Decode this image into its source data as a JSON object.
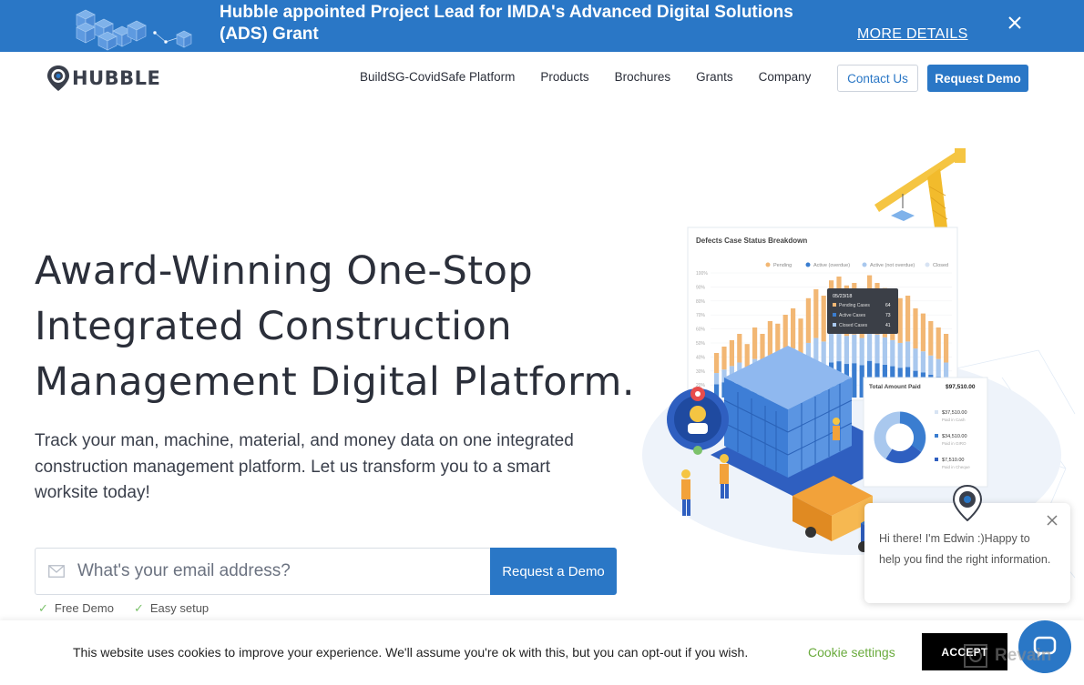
{
  "banner": {
    "text": "Hubble appointed Project Lead for IMDA's Advanced Digital Solutions (ADS) Grant",
    "link_label": "MORE DETAILS"
  },
  "nav": {
    "logo_text": "HUBBLE",
    "links": [
      "BuildSG-CovidSafe Platform",
      "Products",
      "Brochures",
      "Grants",
      "Company"
    ],
    "contact_label": "Contact Us",
    "demo_label": "Request Demo"
  },
  "hero": {
    "title_lines": [
      "Award-Winning One-Stop",
      "Integrated Construction",
      "Management Digital Platform."
    ],
    "subtitle": "Track your man, machine, material, and money data on one integrated construction management platform. Let us transform you to a smart worksite today!",
    "email_placeholder": "What's your email address?",
    "request_label": "Request a Demo",
    "checks": [
      "Free Demo",
      "Easy setup"
    ]
  },
  "illustration": {
    "chart_card": {
      "title": "Defects Case Status Breakdown",
      "legend": [
        "Pending",
        "Active (overdue)",
        "Active (not overdue)",
        "Closed"
      ],
      "y_ticks": [
        "100%",
        "90%",
        "80%",
        "70%",
        "60%",
        "50%",
        "40%",
        "30%",
        "20%",
        "10%"
      ],
      "tooltip": {
        "date": "05/23/18",
        "rows": [
          {
            "label": "Pending Cases",
            "value": "64"
          },
          {
            "label": "Active Cases",
            "value": "73"
          },
          {
            "label": "Closed Cases",
            "value": "41"
          }
        ]
      }
    },
    "payment_card": {
      "title": "Total Amount Paid",
      "total": "$97,510.00",
      "items": [
        {
          "amount": "$37,510.00",
          "label": "Paid in Cash"
        },
        {
          "amount": "$34,510.00",
          "label": "Paid in GIRO"
        },
        {
          "amount": "$7,510.00",
          "label": "Paid in Cheque"
        }
      ]
    },
    "colors": {
      "pending": "#f2b774",
      "active_overdue": "#3a7dd0",
      "active_not_overdue": "#a9c8ee",
      "closed": "#d7e3f3"
    }
  },
  "chat": {
    "message": "Hi there! I'm Edwin :)Happy to help you find the right information."
  },
  "cookie": {
    "text": "This website uses cookies to improve your experience. We'll assume you're ok with this, but you can opt-out if you wish.",
    "settings_label": "Cookie settings",
    "accept_label": "ACCEPT"
  },
  "watermark": "Revain",
  "colors": {
    "brand": "#2a77c6",
    "check": "#7cc26b",
    "cookie_link": "#6aab3d"
  }
}
